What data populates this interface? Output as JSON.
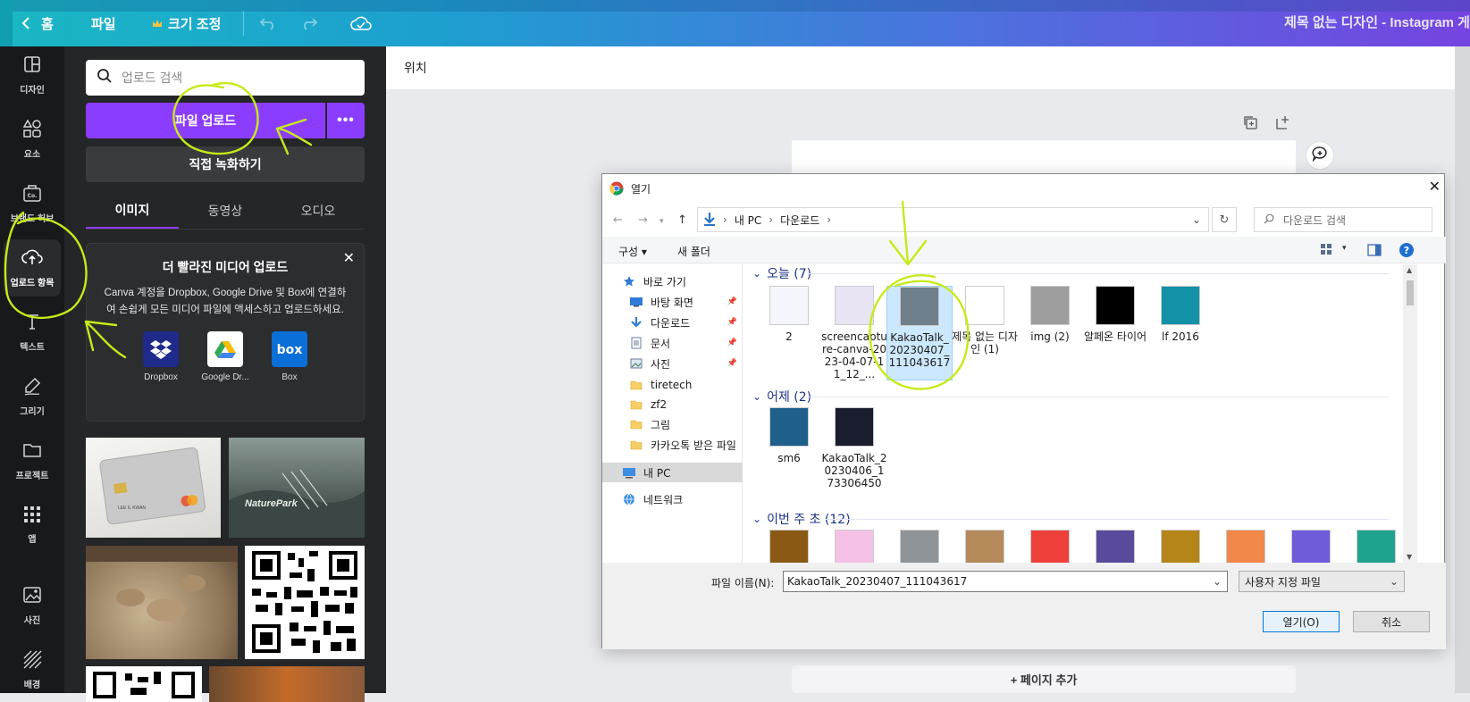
{
  "topbar": {
    "home": "홈",
    "file": "파일",
    "resize": "크기 조정",
    "title": "제목 없는 디자인 - Instagram 게"
  },
  "rail": [
    {
      "label": "디자인",
      "icon": "layout-icon"
    },
    {
      "label": "요소",
      "icon": "shapes-icon"
    },
    {
      "label": "브랜드 허브",
      "icon": "brand-icon"
    },
    {
      "label": "업로드 항목",
      "icon": "upload-cloud-icon"
    },
    {
      "label": "텍스트",
      "icon": "text-icon"
    },
    {
      "label": "그리기",
      "icon": "draw-icon"
    },
    {
      "label": "프로젝트",
      "icon": "folder-icon"
    },
    {
      "label": "앱",
      "icon": "apps-icon"
    },
    {
      "label": "사진",
      "icon": "photo-icon"
    },
    {
      "label": "배경",
      "icon": "background-icon"
    }
  ],
  "panel": {
    "search_placeholder": "업로드 검색",
    "upload_label": "파일 업로드",
    "more_label": "•••",
    "record_label": "직접 녹화하기",
    "tabs": [
      "이미지",
      "동영상",
      "오디오"
    ],
    "promo": {
      "title": "더 빨라진 미디어 업로드",
      "body": "Canva 계정을 Dropbox, Google Drive 및 Box에 연결하여 손쉽게 모든 미디어 파일에 액세스하고 업로드하세요.",
      "services": [
        "Dropbox",
        "Google Dr...",
        "Box"
      ]
    },
    "thumb_text": {
      "card": "LEE IL KWAN",
      "nature": "NaturePark"
    }
  },
  "canvas": {
    "position_label": "위치",
    "add_page": "+ 페이지 추가"
  },
  "dialog": {
    "title": "열기",
    "breadcrumb": [
      "내 PC",
      "다운로드"
    ],
    "search_placeholder": "다운로드 검색",
    "organize": "구성",
    "new_folder": "새 폴더",
    "tree": [
      {
        "label": "바로 가기",
        "kind": "quick"
      },
      {
        "label": "바탕 화면",
        "kind": "desktop",
        "pinned": true
      },
      {
        "label": "다운로드",
        "kind": "download",
        "pinned": true
      },
      {
        "label": "문서",
        "kind": "doc",
        "pinned": true
      },
      {
        "label": "사진",
        "kind": "pic",
        "pinned": true
      },
      {
        "label": "tiretech",
        "kind": "folder"
      },
      {
        "label": "zf2",
        "kind": "folder"
      },
      {
        "label": "그림",
        "kind": "folder"
      },
      {
        "label": "카카오톡 받은 파일",
        "kind": "folder"
      },
      {
        "label": "내 PC",
        "kind": "pc",
        "selected": true
      },
      {
        "label": "네트워크",
        "kind": "net"
      }
    ],
    "groups": [
      {
        "label": "오늘 (7)",
        "files": [
          {
            "name": "2",
            "color": "#f4f6fb"
          },
          {
            "name": "screencapture-canva-2023-04-07-11_12_...",
            "color": "#e9e4f4"
          },
          {
            "name": "KakaoTalk_20230407_111043617",
            "color": "#6f7f8c",
            "selected": true
          },
          {
            "name": "제목 없는 디자인 (1)",
            "color": "#ffffff"
          },
          {
            "name": "img (2)",
            "color": "#9e9e9e"
          },
          {
            "name": "알페온 타이어",
            "color": "#000000"
          },
          {
            "name": "lf 2016",
            "color": "#1391a6"
          }
        ]
      },
      {
        "label": "어제 (2)",
        "files": [
          {
            "name": "sm6",
            "color": "#1e5f8c"
          },
          {
            "name": "KakaoTalk_20230406_173306450",
            "color": "#1a1d2e"
          }
        ]
      },
      {
        "label": "이번 주 초 (12)",
        "files": [
          {
            "name": "",
            "color": "#8a5a14"
          },
          {
            "name": "",
            "color": "#f6c1e6"
          },
          {
            "name": "",
            "color": "#8f9498"
          },
          {
            "name": "",
            "color": "#b58a5a"
          },
          {
            "name": "",
            "color": "#ef3f3a"
          },
          {
            "name": "",
            "color": "#5a4a9c"
          },
          {
            "name": "",
            "color": "#b5851a"
          },
          {
            "name": "",
            "color": "#f2874a"
          },
          {
            "name": "",
            "color": "#6e5cd8"
          },
          {
            "name": "",
            "color": "#1fa38f"
          }
        ]
      }
    ],
    "filename_label": "파일 이름(N):",
    "filename_value": "KakaoTalk_20230407_111043617",
    "filetype_value": "사용자 지정 파일",
    "open_label": "열기(O)",
    "cancel_label": "취소"
  },
  "colors": {
    "accent": "#8b3dff",
    "annotation": "#c6ea1a"
  }
}
